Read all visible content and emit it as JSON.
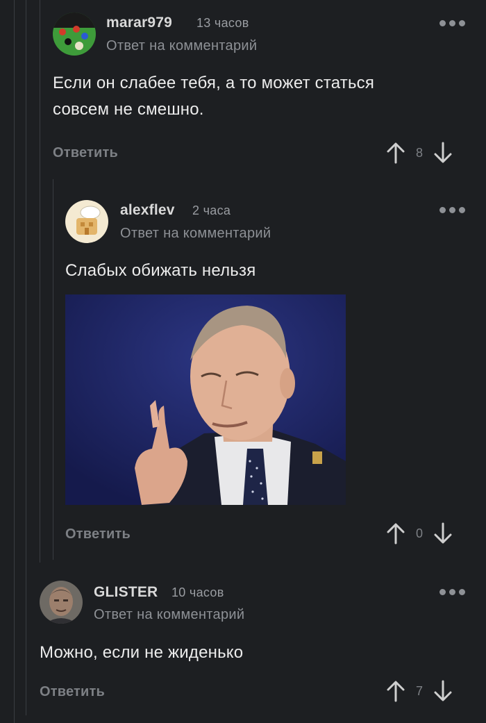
{
  "comments": [
    {
      "username": "marar979",
      "time": "13 часов",
      "reply_label": "Ответ на комментарий",
      "text_lines": [
        "Если он слабее тебя, а то может статься",
        "совсем не смешно."
      ],
      "reply_button": "Ответить",
      "rating": "8"
    },
    {
      "username": "alexflev",
      "time": "2 часа",
      "reply_label": "Ответ на комментарий",
      "text": "Слабых обижать нельзя",
      "reply_button": "Ответить",
      "rating": "0"
    },
    {
      "username": "GLISTER",
      "time": "10 часов",
      "reply_label": "Ответ на комментарий",
      "text": "Можно, если не жиденько",
      "reply_button": "Ответить",
      "rating": "7"
    }
  ],
  "colors": {
    "background": "#1d1f22",
    "text": "#ececec",
    "muted": "#8e9196",
    "thread_line": "#3a3d42"
  },
  "icons": [
    "more-dots-icon",
    "arrow-up-icon",
    "arrow-down-icon"
  ]
}
